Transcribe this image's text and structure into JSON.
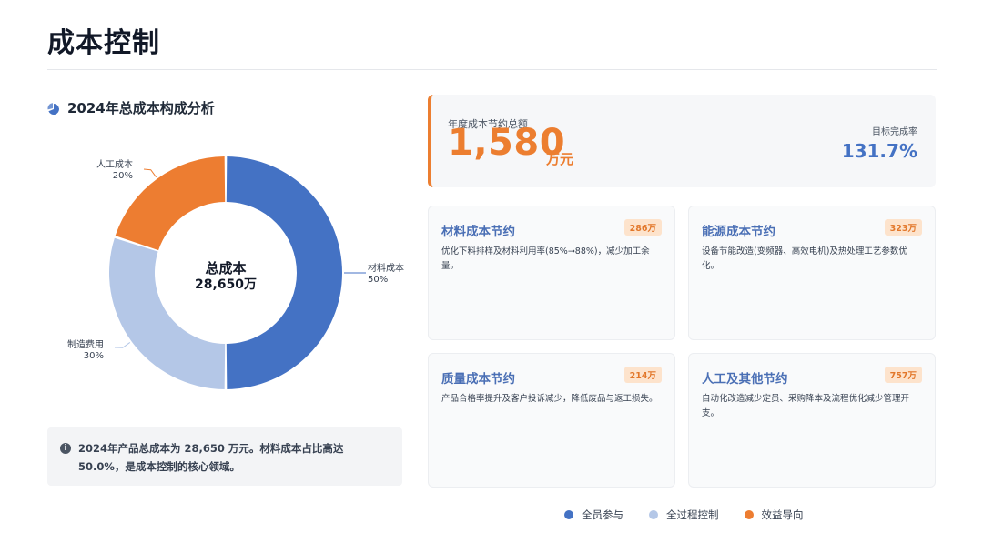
{
  "page": {
    "title": "成本控制"
  },
  "section": {
    "title": "2024年总成本构成分析",
    "icon": "pie-chart-icon"
  },
  "chart_data": {
    "type": "pie",
    "variant": "donut",
    "title": "2024年总成本构成分析",
    "center_label": "总成本",
    "center_value": "28,650万",
    "slices": [
      {
        "name": "材料成本",
        "percent": 50,
        "label": "50%",
        "color": "#4472c4"
      },
      {
        "name": "制造费用",
        "percent": 30,
        "label": "30%",
        "color": "#b4c7e7"
      },
      {
        "name": "人工成本",
        "percent": 20,
        "label": "20%",
        "color": "#ed7d31"
      }
    ]
  },
  "note": {
    "icon": "info-icon",
    "text": "2024年产品总成本为 28,650 万元。材料成本占比高达 50.0%，是成本控制的核心领域。"
  },
  "summary": {
    "label": "年度成本节约总额",
    "value": "1,580",
    "unit": "万元",
    "rate_label": "目标完成率",
    "rate_value": "131.7%",
    "accent": "#ec7e30"
  },
  "cards": [
    {
      "title": "材料成本节约",
      "badge": "286万",
      "desc": "优化下料排样及材料利用率(85%→88%)，减少加工余量。"
    },
    {
      "title": "能源成本节约",
      "badge": "323万",
      "desc": "设备节能改造(变频器、高效电机)及热处理工艺参数优化。"
    },
    {
      "title": "质量成本节约",
      "badge": "214万",
      "desc": "产品合格率提升及客户投诉减少，降低废品与返工损失。"
    },
    {
      "title": "人工及其他节约",
      "badge": "757万",
      "desc": "自动化改造减少定员、采购降本及流程优化减少管理开支。"
    }
  ],
  "legend": [
    {
      "label": "全员参与",
      "color": "#4472c4"
    },
    {
      "label": "全过程控制",
      "color": "#b4c7e7"
    },
    {
      "label": "效益导向",
      "color": "#ed7d31"
    }
  ]
}
